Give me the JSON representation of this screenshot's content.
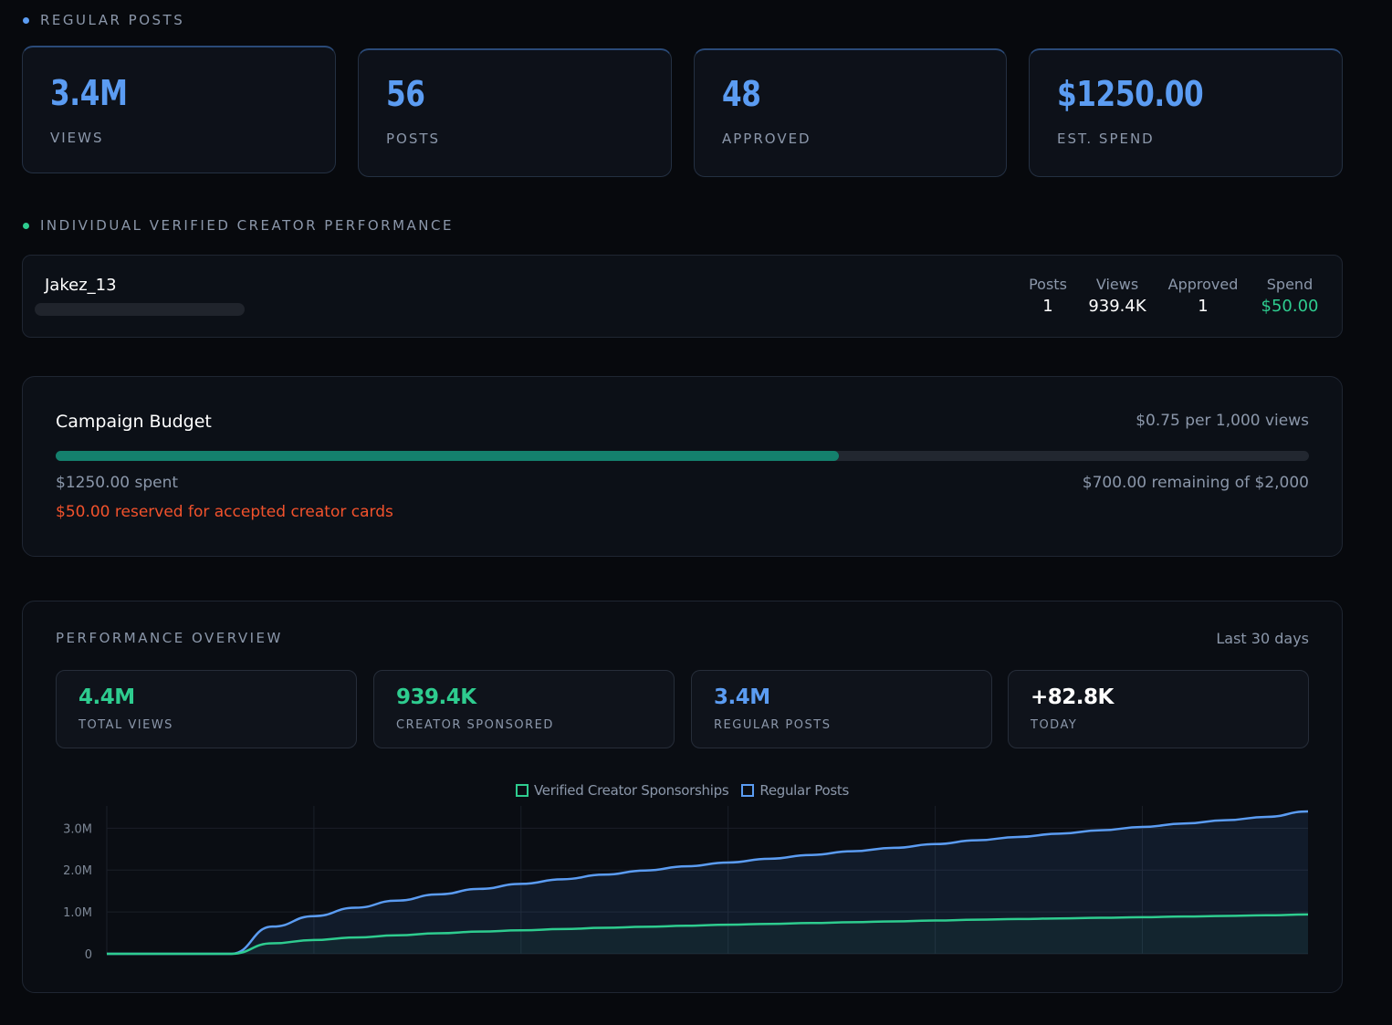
{
  "regular_posts": {
    "section_label": "REGULAR POSTS",
    "accent": "#5b9cf2",
    "stats": [
      {
        "value": "3.4M",
        "label": "VIEWS"
      },
      {
        "value": "56",
        "label": "POSTS"
      },
      {
        "value": "48",
        "label": "APPROVED"
      },
      {
        "value": "$1250.00",
        "label": "EST. SPEND"
      }
    ]
  },
  "creator_performance": {
    "section_label": "INDIVIDUAL VERIFIED CREATOR PERFORMANCE",
    "accent": "#2ecc8f",
    "creator": {
      "name": "Jakez_13",
      "posts_label": "Posts",
      "posts": "1",
      "views_label": "Views",
      "views": "939.4K",
      "approved_label": "Approved",
      "approved": "1",
      "spend_label": "Spend",
      "spend": "$50.00"
    }
  },
  "budget": {
    "title": "Campaign Budget",
    "rate": "$0.75 per 1,000 views",
    "spent": "$1250.00 spent",
    "remaining": "$700.00 remaining of $2,000",
    "reserved": "$50.00 reserved for accepted creator cards",
    "progress_fraction": 0.625,
    "bar_color": "#14806d",
    "reserved_color": "#f2522c"
  },
  "performance": {
    "title": "PERFORMANCE OVERVIEW",
    "range": "Last 30 days",
    "cards": [
      {
        "value": "4.4M",
        "label": "TOTAL VIEWS",
        "color": "#2ecc8f"
      },
      {
        "value": "939.4K",
        "label": "CREATOR SPONSORED",
        "color": "#2ecc8f"
      },
      {
        "value": "3.4M",
        "label": "REGULAR POSTS",
        "color": "#5b9cf2"
      },
      {
        "value": "+82.8K",
        "label": "TODAY",
        "color": "#ffffff"
      }
    ]
  },
  "chart_data": {
    "type": "area",
    "x": [
      0,
      1,
      2,
      3,
      4,
      5,
      6,
      7,
      8,
      9,
      10,
      11,
      12,
      13,
      14,
      15,
      16,
      17,
      18,
      19,
      20,
      21,
      22,
      23,
      24,
      25,
      26,
      27,
      28,
      29
    ],
    "yticks": [
      "0",
      "1.0M",
      "2.0M",
      "3.0M"
    ],
    "ylim": [
      0,
      3400000
    ],
    "grid": true,
    "legend_position": "top-center",
    "series": [
      {
        "name": "Verified Creator Sponsorships",
        "color": "#2ecc8f",
        "values": [
          0,
          0,
          0,
          0,
          250000,
          330000,
          390000,
          440000,
          490000,
          530000,
          560000,
          590000,
          620000,
          645000,
          670000,
          695000,
          715000,
          735000,
          755000,
          775000,
          795000,
          815000,
          830000,
          845000,
          860000,
          875000,
          890000,
          905000,
          920000,
          939400
        ]
      },
      {
        "name": "Regular Posts",
        "color": "#5b9cf2",
        "values": [
          0,
          0,
          0,
          0,
          650000,
          900000,
          1100000,
          1270000,
          1420000,
          1550000,
          1670000,
          1780000,
          1890000,
          1990000,
          2090000,
          2180000,
          2270000,
          2360000,
          2450000,
          2530000,
          2620000,
          2710000,
          2790000,
          2870000,
          2950000,
          3030000,
          3110000,
          3190000,
          3270000,
          3400000
        ]
      }
    ]
  }
}
